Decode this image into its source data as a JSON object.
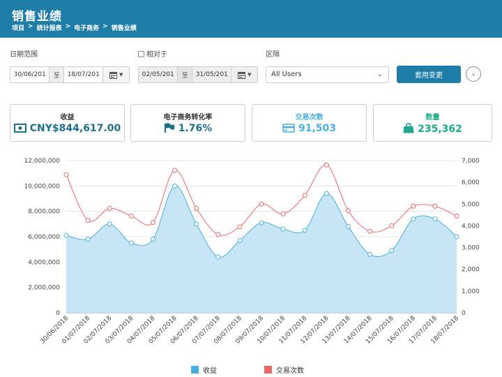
{
  "header": {
    "title": "销售业绩",
    "breadcrumbs": [
      "项目",
      "统计报表",
      "电子商务",
      "销售业绩"
    ],
    "separator": ">"
  },
  "filters": {
    "date_range_label": "日期范围",
    "compare_label": "相对于",
    "interval_label": "区隔",
    "from_date": "30/06/201",
    "to_word": "至",
    "to_date": "18/07/201",
    "compare_from": "02/05/201",
    "compare_to": "31/05/201",
    "segment_value": "All Users",
    "apply_label": "套用变更"
  },
  "cards": [
    {
      "title": "收益",
      "value": "CNY$844,617.00",
      "icon": "money-icon",
      "color": "#1f6f8b"
    },
    {
      "title": "电子商务转化率",
      "value": "1.76%",
      "icon": "flag-icon",
      "color": "#1f6f8b"
    },
    {
      "title": "交易次数",
      "value": "91,503",
      "icon": "credit-card-icon",
      "color": "#4aaee0"
    },
    {
      "title": "数量",
      "value": "235,362",
      "icon": "shopping-bag-icon",
      "color": "#1aaa8a"
    }
  ],
  "colors": {
    "revenue": "#4aaee0",
    "revenue_fill": "#c8e5f5",
    "transactions": "#e8686a",
    "header": "#1f7ea7"
  },
  "chart_data": {
    "type": "area",
    "categories": [
      "30/06/2018",
      "01/07/2018",
      "02/07/2018",
      "03/07/2018",
      "04/07/2018",
      "05/07/2018",
      "06/07/2018",
      "07/07/2018",
      "08/07/2018",
      "09/07/2018",
      "10/07/2018",
      "11/07/2018",
      "12/07/2018",
      "13/07/2018",
      "14/07/2018",
      "15/07/2018",
      "16/07/2018",
      "17/07/2018",
      "18/07/2018"
    ],
    "series": [
      {
        "name": "收益",
        "axis": "left",
        "type": "area",
        "values": [
          6100000,
          5800000,
          7000000,
          5500000,
          5800000,
          10000000,
          7000000,
          4400000,
          5700000,
          7100000,
          6600000,
          6500000,
          9400000,
          6800000,
          4600000,
          4900000,
          7400000,
          7400000,
          6000000
        ]
      },
      {
        "name": "交易次数",
        "axis": "right",
        "type": "line",
        "values": [
          6350,
          4250,
          4800,
          4450,
          4150,
          6550,
          4800,
          3600,
          3950,
          5000,
          4550,
          5400,
          6800,
          4700,
          3750,
          4000,
          4900,
          4900,
          4450
        ]
      }
    ],
    "y_left": {
      "min": 0,
      "max": 12000000,
      "ticks": [
        "0",
        "2,000,000",
        "4,000,000",
        "6,000,000",
        "8,000,000",
        "10,000,000",
        "12,000,000"
      ]
    },
    "y_right": {
      "min": 0,
      "max": 7000,
      "ticks": [
        "0",
        "1,000",
        "2,000",
        "3,000",
        "4,000",
        "5,000",
        "6,000",
        "7,000"
      ]
    },
    "grid": true,
    "legend_position": "bottom"
  }
}
